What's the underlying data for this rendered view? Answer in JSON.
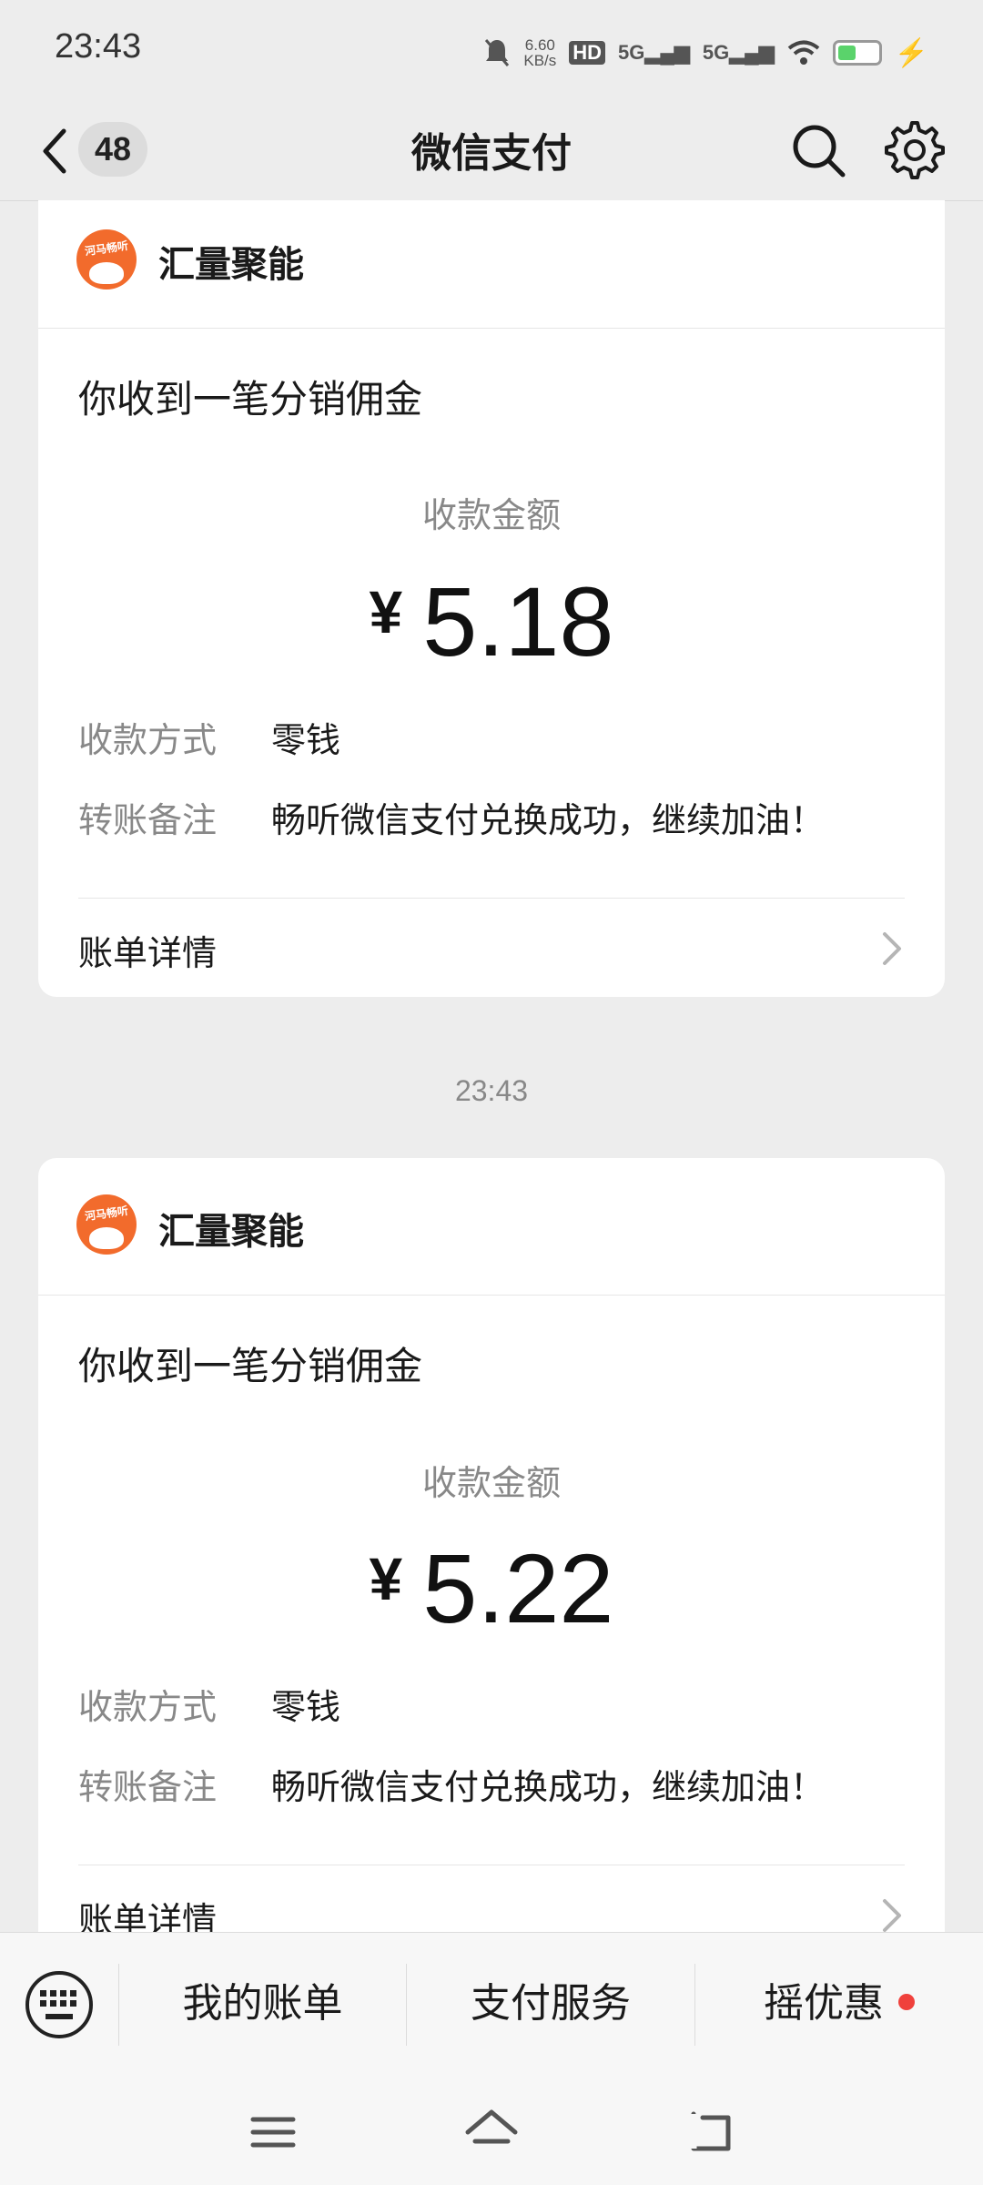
{
  "status_bar": {
    "time": "23:43",
    "net_speed_value": "6.60",
    "net_speed_unit": "KB/s",
    "hd_label": "HD",
    "sim1_label": "5G",
    "sim2_label": "5G",
    "battery_level": 0.45
  },
  "nav": {
    "unread_count": "48",
    "title": "微信支付"
  },
  "messages": [
    {
      "merchant": "汇量聚能",
      "logo_text": "河马畅听",
      "title": "你收到一笔分销佣金",
      "amount_label": "收款金额",
      "currency": "¥",
      "amount": "5.18",
      "method_label": "收款方式",
      "method": "零钱",
      "note_label": "转账备注",
      "note": "畅听微信支付兑换成功，继续加油！",
      "detail_label": "账单详情"
    },
    {
      "merchant": "汇量聚能",
      "logo_text": "河马畅听",
      "title": "你收到一笔分销佣金",
      "amount_label": "收款金额",
      "currency": "¥",
      "amount": "5.22",
      "method_label": "收款方式",
      "method": "零钱",
      "note_label": "转账备注",
      "note": "畅听微信支付兑换成功，继续加油！",
      "detail_label": "账单详情"
    }
  ],
  "timestamp": "23:43",
  "menu": {
    "items": [
      "我的账单",
      "支付服务",
      "摇优惠"
    ]
  },
  "colors": {
    "background": "#ededed",
    "card": "#ffffff",
    "logo": "#f26b2c",
    "red_dot": "#f0413c"
  }
}
